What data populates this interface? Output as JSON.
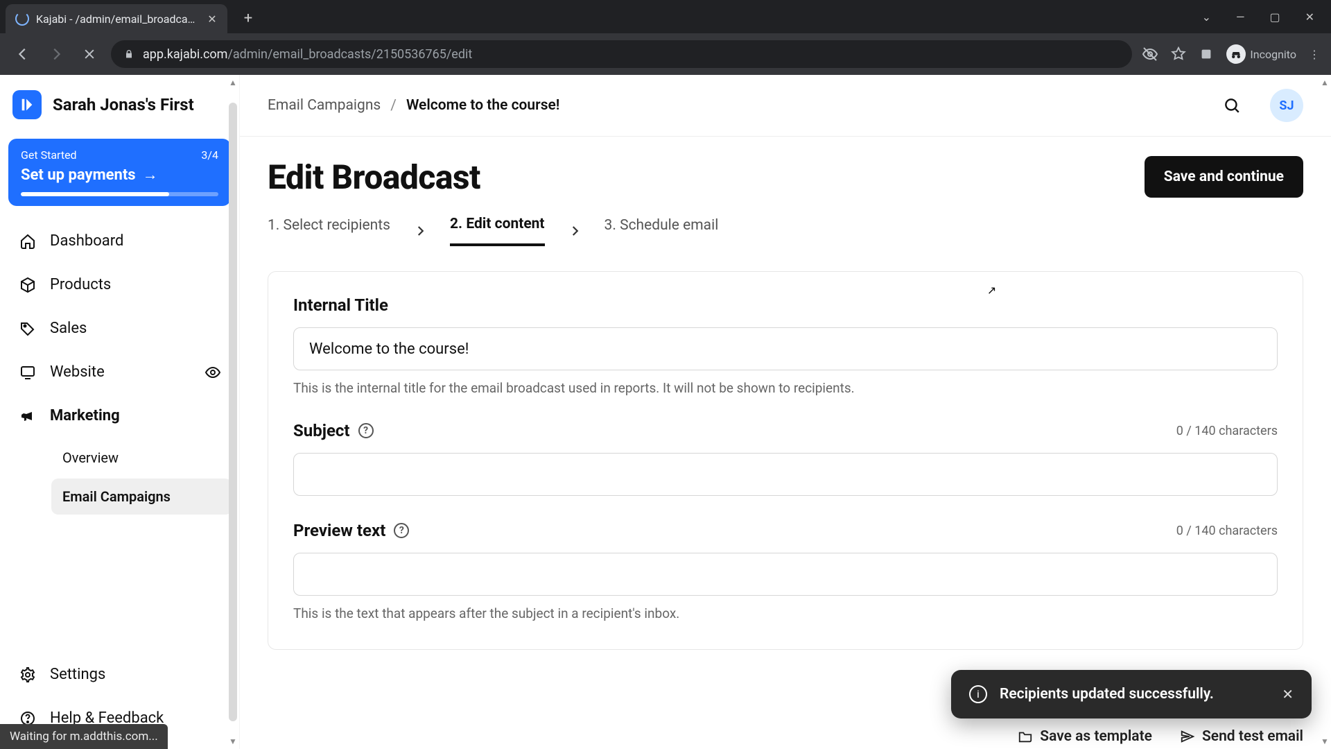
{
  "browser": {
    "tab_title": "Kajabi - /admin/email_broadcasts",
    "url_host": "app.kajabi.com",
    "url_path": "/admin/email_broadcasts/2150536765/edit",
    "incognito_label": "Incognito"
  },
  "sidebar": {
    "brand": "Sarah Jonas's First",
    "get_started": {
      "label": "Get Started",
      "progress_label": "3/4",
      "action": "Set up payments"
    },
    "items": [
      {
        "label": "Dashboard"
      },
      {
        "label": "Products"
      },
      {
        "label": "Sales"
      },
      {
        "label": "Website"
      },
      {
        "label": "Marketing"
      }
    ],
    "marketing_sub": [
      {
        "label": "Overview"
      },
      {
        "label": "Email Campaigns"
      }
    ],
    "bottom": [
      {
        "label": "Settings"
      },
      {
        "label": "Help & Feedback"
      }
    ]
  },
  "header": {
    "breadcrumb_root": "Email Campaigns",
    "breadcrumb_current": "Welcome to the course!",
    "user_initials": "SJ"
  },
  "page": {
    "title": "Edit Broadcast",
    "save_label": "Save and continue",
    "steps": [
      {
        "label": "1. Select recipients"
      },
      {
        "label": "2. Edit content"
      },
      {
        "label": "3. Schedule email"
      }
    ],
    "internal_title_label": "Internal Title",
    "internal_title_value": "Welcome to the course!",
    "internal_title_helper": "This is the internal title for the email broadcast used in reports. It will not be shown to recipients.",
    "subject_label": "Subject",
    "subject_counter": "0 / 140 characters",
    "preview_label": "Preview text",
    "preview_counter": "0 / 140 characters",
    "preview_helper": "This is the text that appears after the subject in a recipient's inbox.",
    "under_actions": {
      "save_template": "Save as template",
      "send_test": "Send test email"
    }
  },
  "toast": {
    "message": "Recipients updated successfully."
  },
  "statusbar": {
    "text": "Waiting for m.addthis.com..."
  }
}
